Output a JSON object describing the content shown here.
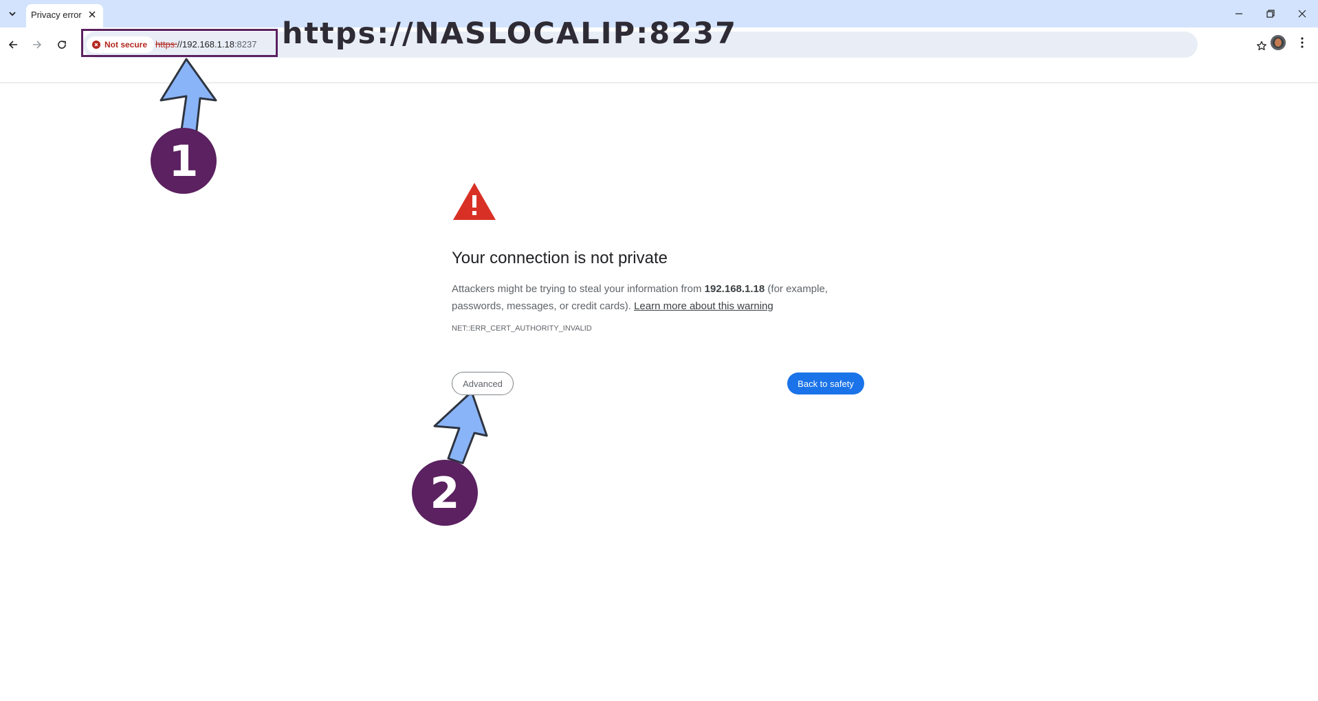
{
  "tab": {
    "title": "Privacy error"
  },
  "omnibox": {
    "security_label": "Not secure",
    "url_scheme": "https:",
    "url_host": "//192.168.1.18",
    "url_port": ":8237"
  },
  "annotation": {
    "url_overlay": "https://NASLOCALIP:8237",
    "step1": "1",
    "step2": "2",
    "arrow_color": "#8ab4f8",
    "circle_color": "#5b2160"
  },
  "interstitial": {
    "heading": "Your connection is not private",
    "body_prefix": "Attackers might be trying to steal your information from ",
    "body_host": "192.168.1.18",
    "body_suffix": " (for example, passwords, messages, or credit cards). ",
    "learn_more": "Learn more about this warning",
    "error_code": "NET::ERR_CERT_AUTHORITY_INVALID",
    "advanced_label": "Advanced",
    "back_label": "Back to safety"
  },
  "colors": {
    "accent": "#1a73e8",
    "danger": "#d93025",
    "tabstrip": "#d3e3fd"
  },
  "icons": {
    "tab_menu": "chevron-down-icon",
    "tab_close": "close-icon",
    "back": "back-arrow-icon",
    "forward": "forward-arrow-icon",
    "reload": "reload-icon",
    "security": "error-circle-icon",
    "bookmark": "star-icon",
    "menu": "kebab-menu-icon",
    "warning": "warning-triangle-icon"
  }
}
